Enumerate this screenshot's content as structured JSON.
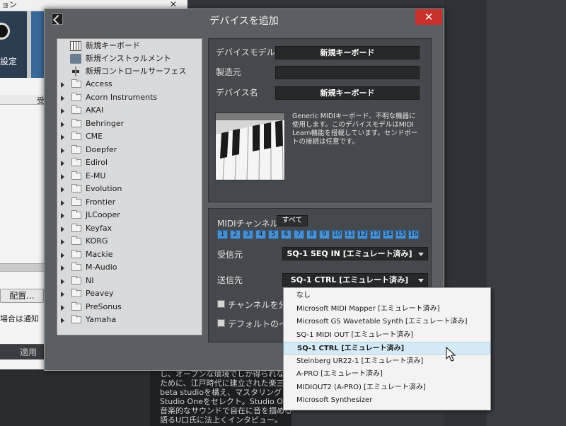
{
  "background": {
    "title_fragment": "ョン",
    "close_glyph": "✕",
    "icon_tile_label": "設定",
    "column_header": "受",
    "placement_button": "配置...",
    "notice_fragment": "場合は通知",
    "apply_button": "適用",
    "article_lines": [
      "し、オープンな環境でしか得られない",
      "ために、江戸時代に建立された楽三",
      "beta studioを構え、マスタリング・ソ",
      "Studio Oneをセレクト。Studio One",
      "音楽的なサウンドで自在に音を掴めるのか魅力と",
      "語るU口氏に法上くインタビュー。"
    ]
  },
  "dialog": {
    "title": "デバイスを追加",
    "close_glyph": "✕",
    "tree": {
      "special_items": [
        {
          "label": "新規キーボード",
          "icon": "keyboard-icon"
        },
        {
          "label": "新規インストゥルメント",
          "icon": "instrument-icon"
        },
        {
          "label": "新規コントロールサーフェス",
          "icon": "control-surface-icon"
        }
      ],
      "folders": [
        "Access",
        "Acorn Instruments",
        "AKAI",
        "Behringer",
        "CME",
        "Doepfer",
        "Edirol",
        "E-MU",
        "Evolution",
        "Frontier",
        "JLCooper",
        "Keyfax",
        "KORG",
        "Mackie",
        "M-Audio",
        "NI",
        "Peavey",
        "PreSonus",
        "Yamaha"
      ]
    },
    "device": {
      "model_label": "デバイスモデル",
      "model_value": "新規キーボード",
      "maker_label": "製造元",
      "maker_value": "",
      "name_label": "デバイス名",
      "name_value": "新規キーボード",
      "description": "Generic MIDIキーボード、不明な機器に使用します。このデバイスモデルはMIDI Learn機能を搭載しています。センドポートの接続は任意です。"
    },
    "midi": {
      "channel_label": "MIDIチャンネル",
      "all_button": "すべて",
      "channels": [
        "1",
        "2",
        "3",
        "4",
        "5",
        "6",
        "7",
        "8",
        "9",
        "10",
        "11",
        "12",
        "13",
        "14",
        "15",
        "16"
      ],
      "receive_label": "受信元",
      "receive_value": "SQ-1 SEQ IN [エミュレート済み]",
      "send_label": "送信先",
      "send_value": "SQ-1 CTRL [エミュレート済み]",
      "split_channel_label": "チャンネルを分割",
      "default_input_label": "デフォルトのイン"
    },
    "send_options": [
      "なし",
      "Microsoft MIDI Mapper [エミュレート済み]",
      "Microsoft GS Wavetable Synth [エミュレート済み]",
      "SQ-1 MIDI OUT [エミュレート済み]",
      "SQ-1 CTRL [エミュレート済み]",
      "Steinberg UR22-1 [エミュレート済み]",
      "A-PRO [エミュレート済み]",
      "MIDIOUT2 (A-PRO) [エミュレート済み]",
      "Microsoft Synthesizer"
    ],
    "selected_option_index": 4
  }
}
